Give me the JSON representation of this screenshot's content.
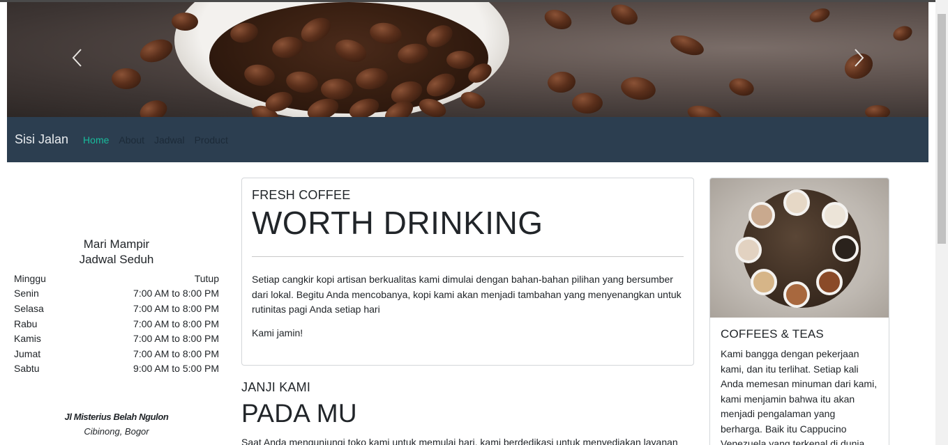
{
  "carousel": {
    "prev_icon": "chevron-left-icon",
    "next_icon": "chevron-right-icon"
  },
  "navbar": {
    "brand": "Sisi Jalan",
    "items": [
      {
        "label": "Home",
        "active": true
      },
      {
        "label": "About",
        "active": false
      },
      {
        "label": "Jadwal",
        "active": false
      },
      {
        "label": "Product",
        "active": false
      }
    ],
    "active_color": "#18bc9c",
    "background": "#2c3e50"
  },
  "schedule": {
    "title_line1": "Mari Mampir",
    "title_line2": "Jadwal Seduh",
    "rows": [
      {
        "day": "Minggu",
        "hours": "Tutup"
      },
      {
        "day": "Senin",
        "hours": "7:00 AM to 8:00 PM"
      },
      {
        "day": "Selasa",
        "hours": "7:00 AM to 8:00 PM"
      },
      {
        "day": "Rabu",
        "hours": "7:00 AM to 8:00 PM"
      },
      {
        "day": "Kamis",
        "hours": "7:00 AM to 8:00 PM"
      },
      {
        "day": "Jumat",
        "hours": "7:00 AM to 8:00 PM"
      },
      {
        "day": "Sabtu",
        "hours": "9:00 AM to 5:00 PM"
      }
    ],
    "address_line1": "Jl Misterius Belah Ngulon",
    "address_line2": "Cibinong, Bogor"
  },
  "main_card": {
    "eyebrow": "FRESH COFFEE",
    "headline": "WORTH DRINKING",
    "paragraph": "Setiap cangkir kopi artisan berkualitas kami dimulai dengan bahan-bahan pilihan yang bersumber dari lokal. Begitu Anda mencobanya, kopi kami akan menjadi tambahan yang menyenangkan untuk rutinitas pagi Anda setiap hari",
    "tagline": "Kami jamin!"
  },
  "promise": {
    "eyebrow": "JANJI KAMI",
    "headline": "PADA MU",
    "paragraph": "Saat Anda mengunjungi toko kami untuk memulai hari, kami berdedikasi untuk menyediakan layanan"
  },
  "side_card": {
    "title": "COFFEES & TEAS",
    "text": "Kami bangga dengan pekerjaan kami, dan itu terlihat. Setiap kali Anda memesan minuman dari kami, kami menjamin bahwa itu akan menjadi pengalaman yang berharga. Baik itu Cappucino Venezuela yang terkenal di dunia atau sesuatu yang"
  }
}
